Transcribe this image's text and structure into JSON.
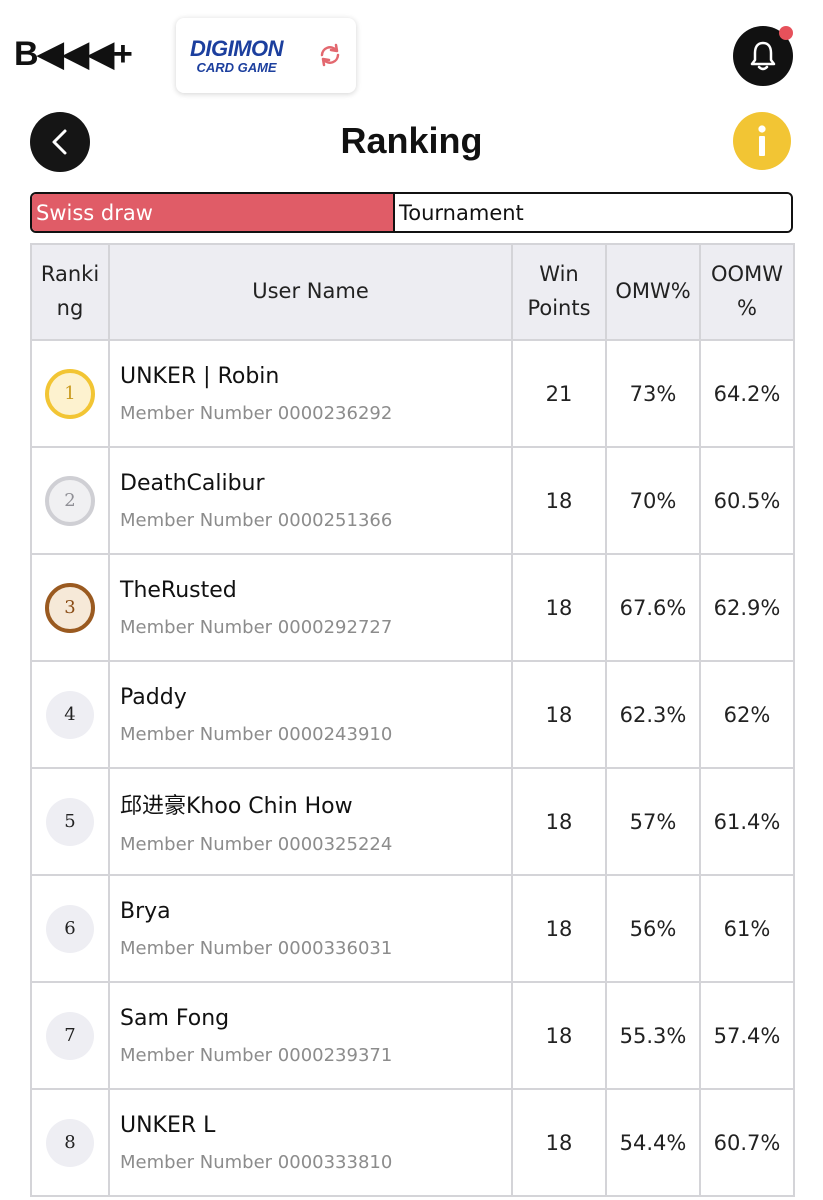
{
  "header": {
    "brand": "B◀◀◀+",
    "game_logo_line1": "DIGIMON",
    "game_logo_line2": "CARD GAME"
  },
  "page": {
    "title": "Ranking"
  },
  "tabs": [
    {
      "label": "Swiss draw",
      "active": true
    },
    {
      "label": "Tournament",
      "active": false
    }
  ],
  "table": {
    "headers": {
      "rank": "Ranki ng",
      "user": "User Name",
      "wp": "Win Points",
      "omw": "OMW%",
      "oomw": "OOMW %"
    },
    "rows": [
      {
        "rank": "1",
        "name": "UNKER | Robin",
        "member": "Member Number 0000236292",
        "wp": "21",
        "omw": "73%",
        "oomw": "64.2%"
      },
      {
        "rank": "2",
        "name": "DeathCalibur",
        "member": "Member Number 0000251366",
        "wp": "18",
        "omw": "70%",
        "oomw": "60.5%"
      },
      {
        "rank": "3",
        "name": "TheRusted",
        "member": "Member Number 0000292727",
        "wp": "18",
        "omw": "67.6%",
        "oomw": "62.9%"
      },
      {
        "rank": "4",
        "name": "Paddy",
        "member": "Member Number 0000243910",
        "wp": "18",
        "omw": "62.3%",
        "oomw": "62%"
      },
      {
        "rank": "5",
        "name": "邱进豪Khoo Chin How",
        "member": "Member Number 0000325224",
        "wp": "18",
        "omw": "57%",
        "oomw": "61.4%"
      },
      {
        "rank": "6",
        "name": "Brya",
        "member": "Member Number 0000336031",
        "wp": "18",
        "omw": "56%",
        "oomw": "61%"
      },
      {
        "rank": "7",
        "name": "Sam Fong",
        "member": "Member Number 0000239371",
        "wp": "18",
        "omw": "55.3%",
        "oomw": "57.4%"
      },
      {
        "rank": "8",
        "name": "UNKER L",
        "member": "Member Number 0000333810",
        "wp": "18",
        "omw": "54.4%",
        "oomw": "60.7%"
      }
    ]
  },
  "colors": {
    "tab_active": "#e05c67",
    "gold": "#f2c534",
    "silver": "#cfcfd4",
    "bronze": "#9a5a20",
    "info": "#f2c534",
    "notification_dot": "#e6515b"
  },
  "icons": {
    "bell": "bell-icon",
    "back": "chevron-left-icon",
    "info": "info-icon",
    "refresh": "refresh-icon"
  }
}
